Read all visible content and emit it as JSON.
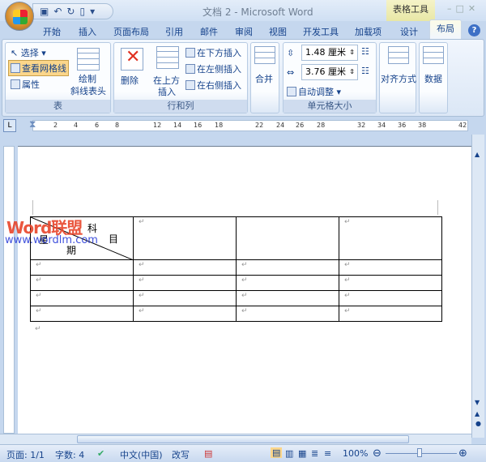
{
  "window": {
    "title": "文档 2 - Microsoft Word",
    "contextual_tab": "表格工具"
  },
  "qat": {
    "icons": "save-icon undo-icon redo-icon new-icon"
  },
  "tabs": [
    "开始",
    "插入",
    "页面布局",
    "引用",
    "邮件",
    "审阅",
    "视图",
    "开发工具",
    "加载项",
    "设计",
    "布局"
  ],
  "active_tab": "布局",
  "ribbon": {
    "table_group": {
      "label": "表",
      "select": "选择",
      "gridlines": "查看网格线",
      "properties": "属性",
      "draw_diag": "绘制\n斜线表头",
      "draw_diag_1": "绘制",
      "draw_diag_2": "斜线表头"
    },
    "rows_cols": {
      "label": "行和列",
      "delete": "删除",
      "insert_above_1": "在上方",
      "insert_above_2": "插入",
      "insert_below": "在下方插入",
      "insert_left": "在左侧插入",
      "insert_right": "在右侧插入"
    },
    "merge": {
      "label": "合并"
    },
    "cell_size": {
      "label": "单元格大小",
      "height": "1.48 厘米",
      "width": "3.76 厘米",
      "autofit": "自动调整"
    },
    "align": {
      "label": "对齐方式"
    },
    "data": {
      "label": "数据"
    }
  },
  "ruler": {
    "ticks": [
      "2",
      "4",
      "6",
      "8",
      "12",
      "14",
      "16",
      "18",
      "22",
      "24",
      "26",
      "28",
      "32",
      "34",
      "36",
      "38",
      "42"
    ]
  },
  "document": {
    "header_cell": {
      "top_right_1": "科",
      "top_right_2": "目",
      "bottom_left_1": "星",
      "bottom_left_2": "期"
    },
    "para_mark": "↵",
    "watermark": {
      "brand": "Word联盟",
      "url": "www.wordlm.com"
    }
  },
  "status": {
    "page": "页面: 1/1",
    "words": "字数: 4",
    "language": "中文(中国)",
    "mode": "改写",
    "zoom": "100%",
    "zoom_level": 100
  }
}
